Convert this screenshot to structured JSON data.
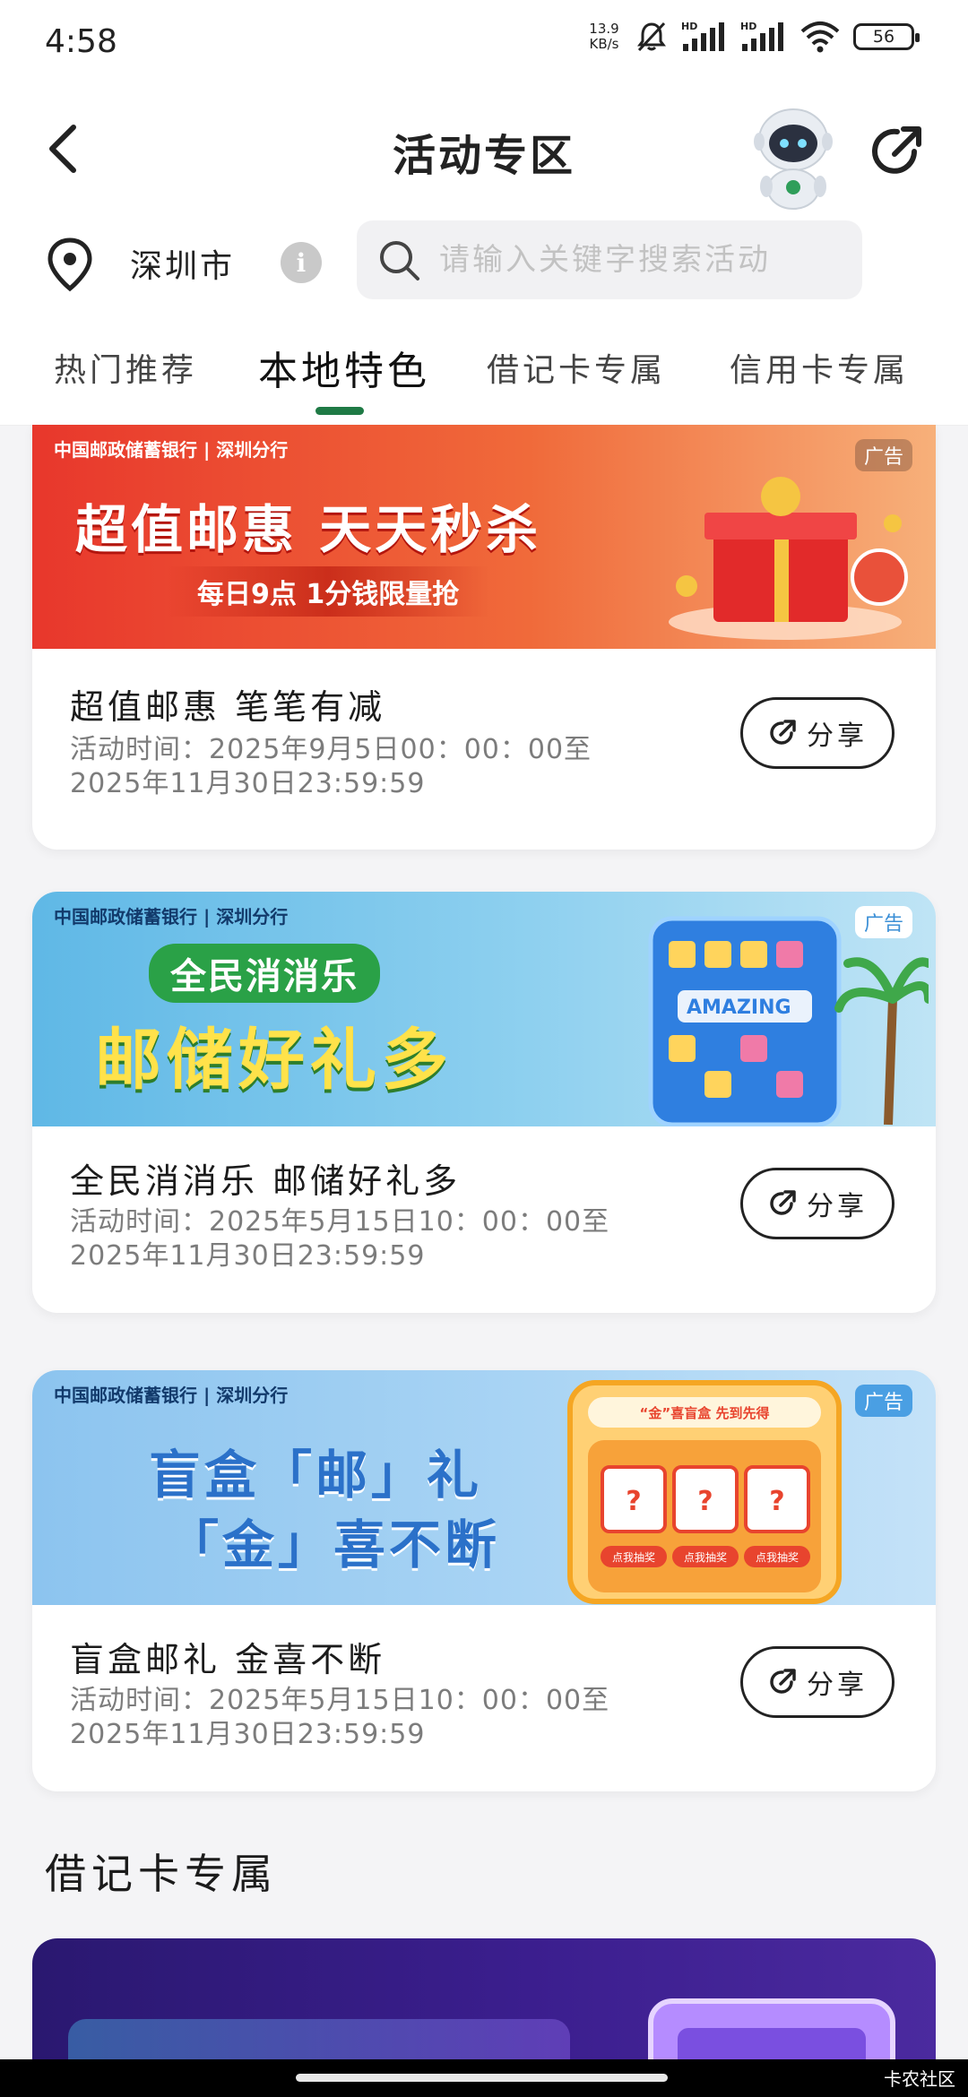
{
  "status": {
    "time": "4:58",
    "netspeed_value": "13.9",
    "netspeed_unit": "KB/s",
    "battery": "56"
  },
  "nav": {
    "title": "活动专区"
  },
  "location": {
    "city": "深圳市",
    "info_glyph": "i"
  },
  "search": {
    "placeholder": "请输入关键字搜索活动"
  },
  "tabs": [
    {
      "label": "热门推荐",
      "active": false
    },
    {
      "label": "本地特色",
      "active": true
    },
    {
      "label": "借记卡专属",
      "active": false
    },
    {
      "label": "信用卡专属",
      "active": false
    }
  ],
  "cards": [
    {
      "banner": {
        "bank": "中国邮政储蓄银行 | 深圳分行",
        "ad": "广告",
        "headline": "超值邮惠 天天秒杀",
        "subline": "每日9点 1分钱限量抢"
      },
      "title": "超值邮惠 笔笔有减",
      "time_line1": "活动时间：2025年9月5日00：00：00至",
      "time_line2": "2025年11月30日23:59:59",
      "share_label": "分享"
    },
    {
      "banner": {
        "bank": "中国邮政储蓄银行 | 深圳分行",
        "ad": "广告",
        "headline": "全民消消乐",
        "subline": "邮储好礼多",
        "art_text": "AMAZING"
      },
      "title": "全民消消乐 邮储好礼多",
      "time_line1": "活动时间：2025年5月15日10：00：00至",
      "time_line2": "2025年11月30日23:59:59",
      "share_label": "分享"
    },
    {
      "banner": {
        "bank": "中国邮政储蓄银行 | 深圳分行",
        "ad": "广告",
        "headline": "盲盒「邮」礼",
        "subline": "「金」喜不断",
        "machine_label": "“金”喜盲盒 先到先得",
        "button_label": "点我抽奖"
      },
      "title": "盲盒邮礼 金喜不断",
      "time_line1": "活动时间：2025年5月15日10：00：00至",
      "time_line2": "2025年11月30日23:59:59",
      "share_label": "分享"
    }
  ],
  "section": {
    "title": "借记卡专属"
  },
  "watermark": "卡农社区",
  "colors": {
    "accent": "#1f7a45",
    "banner1": "#e8442e",
    "banner2": "#5fb8e6",
    "banner3": "#8fc6f0",
    "bottom_banner": "#2a1870"
  }
}
